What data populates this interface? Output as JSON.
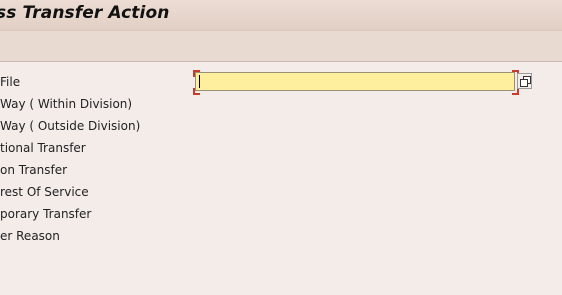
{
  "window": {
    "title": "ss Transfer Action"
  },
  "form": {
    "file_label": "File",
    "file_value": "",
    "options": [
      "Way ( Within Division)",
      "Way ( Outside Division)",
      "tional Transfer",
      "on Transfer",
      "rest Of Service",
      "porary Transfer",
      "er Reason"
    ]
  }
}
